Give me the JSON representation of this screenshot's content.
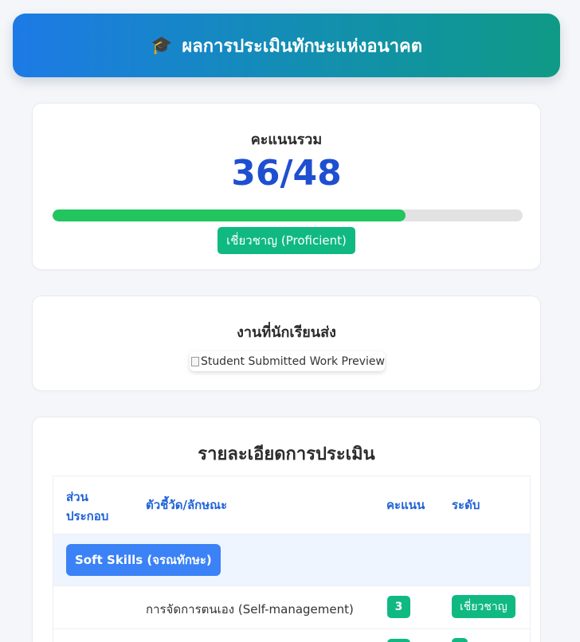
{
  "header": {
    "icon": "graduation-cap-icon",
    "icon_glyph": "🎓",
    "title": "ผลการประเมินทักษะแห่งอนาคต"
  },
  "score": {
    "label": "คะแนนรวม",
    "value": "36/48",
    "progress_fraction": 0.75,
    "level": "เชี่ยวชาญ (Proficient)"
  },
  "work": {
    "title": "งานที่นักเรียนส่ง",
    "image_alt": "Student Submitted Work Preview"
  },
  "details": {
    "title": "รายละเอียดการประเมิน",
    "columns": {
      "component": "ส่วนประกอบ",
      "indicator": "ตัวชี้วัด/ลักษณะ",
      "score": "คะแนน",
      "level": "ระดับ"
    },
    "section": "Soft Skills (จรณทักษะ)",
    "rows": [
      {
        "indicator": "การจัดการตนเอง (Self-management)",
        "score": "3",
        "level": "เชี่ยวชาญ"
      },
      {
        "indicator": "",
        "score": "",
        "level": ""
      }
    ]
  },
  "colors": {
    "header_gradient_start": "#1d7ae6",
    "header_gradient_end": "#0f9a86",
    "score_value": "#1f4fd1",
    "progress_fill": "#22c55e",
    "badge_green": "#10b981",
    "section_blue": "#3b82f6"
  }
}
